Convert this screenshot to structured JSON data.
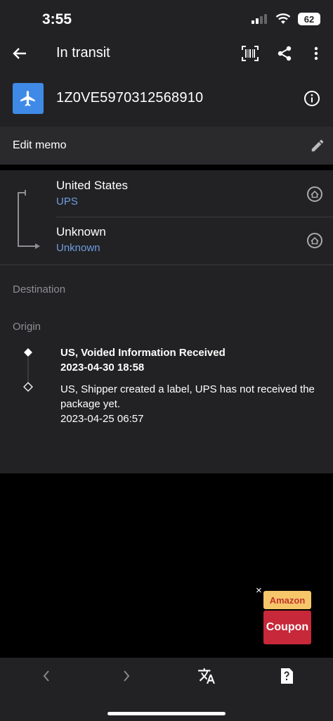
{
  "status": {
    "time": "3:55",
    "battery": "62"
  },
  "header": {
    "title": "In transit"
  },
  "package": {
    "tracking_number": "1Z0VE5970312568910"
  },
  "memo": {
    "label": "Edit memo"
  },
  "route": {
    "from": {
      "country": "United States",
      "carrier": "UPS"
    },
    "to": {
      "country": "Unknown",
      "carrier": "Unknown"
    }
  },
  "sections": {
    "destination": "Destination",
    "origin": "Origin"
  },
  "events": [
    {
      "title": "US, Voided Information Received",
      "time": "2023-04-30 18:58"
    },
    {
      "text": "US, Shipper created a label, UPS has not received the package yet.",
      "time": "2023-04-25 06:57"
    }
  ],
  "ad": {
    "line1": "Amazon",
    "line2": "Coupon",
    "close": "×"
  },
  "colors": {
    "accent": "#3f8ae6",
    "link": "#6e9ee0",
    "surface": "#222224",
    "background": "#000000"
  },
  "icons": [
    "back-arrow-icon",
    "barcode-icon",
    "share-icon",
    "more-vert-icon",
    "airplane-icon",
    "info-icon",
    "pencil-icon",
    "home-icon",
    "chevron-left-icon",
    "chevron-right-icon",
    "translate-icon",
    "help-card-icon"
  ]
}
